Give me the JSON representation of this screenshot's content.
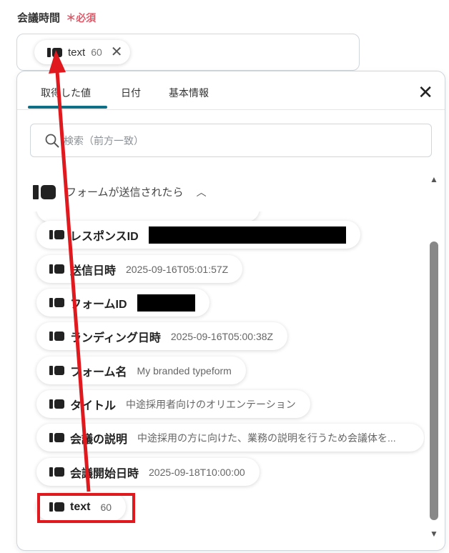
{
  "field": {
    "label": "会議時間",
    "required_mark": "＊",
    "required_text": "必須"
  },
  "selected_value": {
    "icon": "tag-icon",
    "label": "text",
    "value": "60",
    "remove_icon": "close-icon"
  },
  "panel": {
    "tabs": [
      {
        "label": "取得した値"
      },
      {
        "label": "日付"
      },
      {
        "label": "基本情報"
      }
    ],
    "active_tab": 0,
    "close_icon": "close-icon",
    "search": {
      "placeholder": "検索（前方一致）",
      "icon": "search-icon"
    },
    "section": {
      "title": "フォームが送信されたら",
      "icon": "tag-icon",
      "expanded": true
    },
    "items": [
      {
        "label": "レスポンスID",
        "value": "",
        "redacted": true
      },
      {
        "label": "送信日時",
        "value": "2025-09-16T05:01:57Z"
      },
      {
        "label": "フォームID",
        "value": "",
        "redacted": true
      },
      {
        "label": "ランディング日時",
        "value": "2025-09-16T05:00:38Z"
      },
      {
        "label": "フォーム名",
        "value": "My branded typeform"
      },
      {
        "label": "タイトル",
        "value": "中途採用者向けのオリエンテーション"
      },
      {
        "label": "会議の説明",
        "value": "中途採用の方に向けた、業務の説明を行うため会議体を..."
      },
      {
        "label": "会議開始日時",
        "value": "2025-09-18T10:00:00"
      },
      {
        "label": "text",
        "value": "60",
        "highlighted": true
      }
    ]
  },
  "colors": {
    "accent": "#0e6f86",
    "required": "#e05a6a",
    "annotation": "#e0191f"
  }
}
